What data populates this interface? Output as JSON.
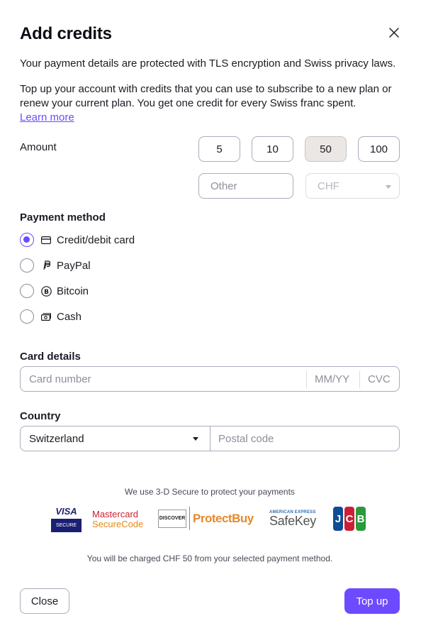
{
  "dialog": {
    "title": "Add credits",
    "security_text": "Your payment details are protected with TLS encryption and Swiss privacy laws.",
    "description": "Top up your account with credits that you can use to subscribe to a new plan or renew your current plan. You get one credit for every Swiss franc spent.",
    "learn_more": "Learn more"
  },
  "amount": {
    "label": "Amount",
    "options": [
      "5",
      "10",
      "50",
      "100"
    ],
    "selected": "50",
    "other_placeholder": "Other",
    "currency": "CHF"
  },
  "payment_method": {
    "label": "Payment method",
    "options": [
      {
        "label": "Credit/debit card",
        "icon": "credit-card-icon",
        "selected": true
      },
      {
        "label": "PayPal",
        "icon": "paypal-icon",
        "selected": false
      },
      {
        "label": "Bitcoin",
        "icon": "bitcoin-icon",
        "selected": false
      },
      {
        "label": "Cash",
        "icon": "cash-icon",
        "selected": false
      }
    ]
  },
  "card": {
    "label": "Card details",
    "number_placeholder": "Card number",
    "expiry_placeholder": "MM/YY",
    "cvc_placeholder": "CVC"
  },
  "country": {
    "label": "Country",
    "value": "Switzerland",
    "postal_placeholder": "Postal code"
  },
  "secure": {
    "note": "We use 3-D Secure to protect your payments",
    "logos": {
      "visa_top": "VISA",
      "visa_bottom": "SECURE",
      "mc_line1": "Mastercard",
      "mc_line2": "SecureCode",
      "discover": "DISCOVER",
      "protectbuy": "ProtectBuy",
      "amex_top": "AMERICAN EXPRESS",
      "amex_bottom": "SafeKey",
      "jcb": [
        "J",
        "C",
        "B"
      ]
    }
  },
  "charge_note": "You will be charged CHF 50 from your selected payment method.",
  "buttons": {
    "close": "Close",
    "top_up": "Top up"
  },
  "colors": {
    "accent": "#6d4aff",
    "text": "#1b1b24",
    "border": "#adabbc",
    "selected_bg": "#eae7e4"
  }
}
